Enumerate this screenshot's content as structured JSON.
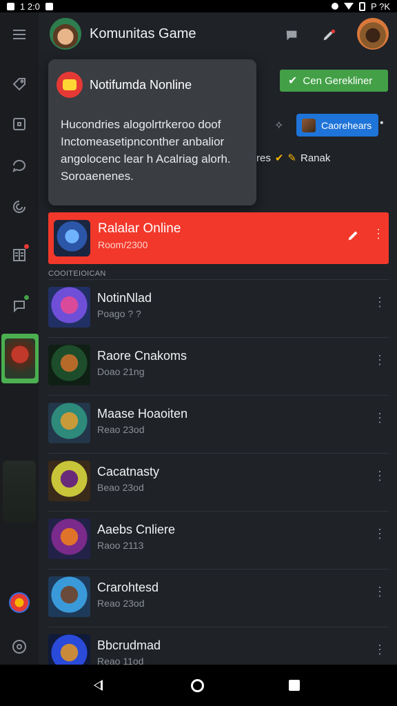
{
  "status_bar": {
    "time": "1 2:0",
    "right_text": "P ?K"
  },
  "header": {
    "title": "Komunitas Game"
  },
  "notification": {
    "title": "Notifumda Nonline",
    "body": "Hucondries alogolrtrkeroo doof Inctomeasetipnconther anbalior angolocenc lear h Acalriag alorh. Soroaenenes."
  },
  "actions": {
    "green_button": "Cen Gerekliner",
    "blue_button": "Caorehears",
    "ranks_prefix": "res",
    "ranks_label": "Ranak"
  },
  "banner": {
    "title": "Ralalar Online",
    "subtitle": "Room/2300"
  },
  "section_label": "COOITEIOICAN",
  "games": [
    {
      "title": "NotinNlad",
      "subtitle": "Poago ? ?",
      "art": [
        "#6f4fd8",
        "#d94a9a",
        "#213064"
      ]
    },
    {
      "title": "Raore Cnakoms",
      "subtitle": "Doao 21ng",
      "art": [
        "#1d4d2b",
        "#b56a2a",
        "#0f1f14"
      ]
    },
    {
      "title": "Maase Hoaoiten",
      "subtitle": "Reao 23od",
      "art": [
        "#2e8a7a",
        "#c99a3a",
        "#23364a"
      ]
    },
    {
      "title": "Cacatnasty",
      "subtitle": "Beao 23od",
      "art": [
        "#c9c53a",
        "#6a2a7a",
        "#3a2a1a"
      ]
    },
    {
      "title": "Aaebs Cnliere",
      "subtitle": "Raoo 2113",
      "art": [
        "#7a2a8a",
        "#e0732a",
        "#222248"
      ]
    },
    {
      "title": "Crarohtesd",
      "subtitle": "Reao 23od",
      "art": [
        "#3a9ad9",
        "#6a4a3a",
        "#1e3a5a"
      ]
    },
    {
      "title": "Bbcrudmad",
      "subtitle": "Reao 11od",
      "art": [
        "#2a4ad9",
        "#c98a3a",
        "#101a3a"
      ]
    }
  ],
  "colors": {
    "accent_red": "#f2382a",
    "accent_green": "#43a047",
    "accent_blue": "#1e74d8",
    "background": "#1f2227"
  },
  "icons": [
    "menu-icon",
    "tag-icon",
    "square-icon",
    "chat-bubble-icon",
    "swirl-icon",
    "book-icon",
    "speech-icon",
    "search-icon",
    "edit-icon",
    "star-icon",
    "more-vert-icon"
  ]
}
